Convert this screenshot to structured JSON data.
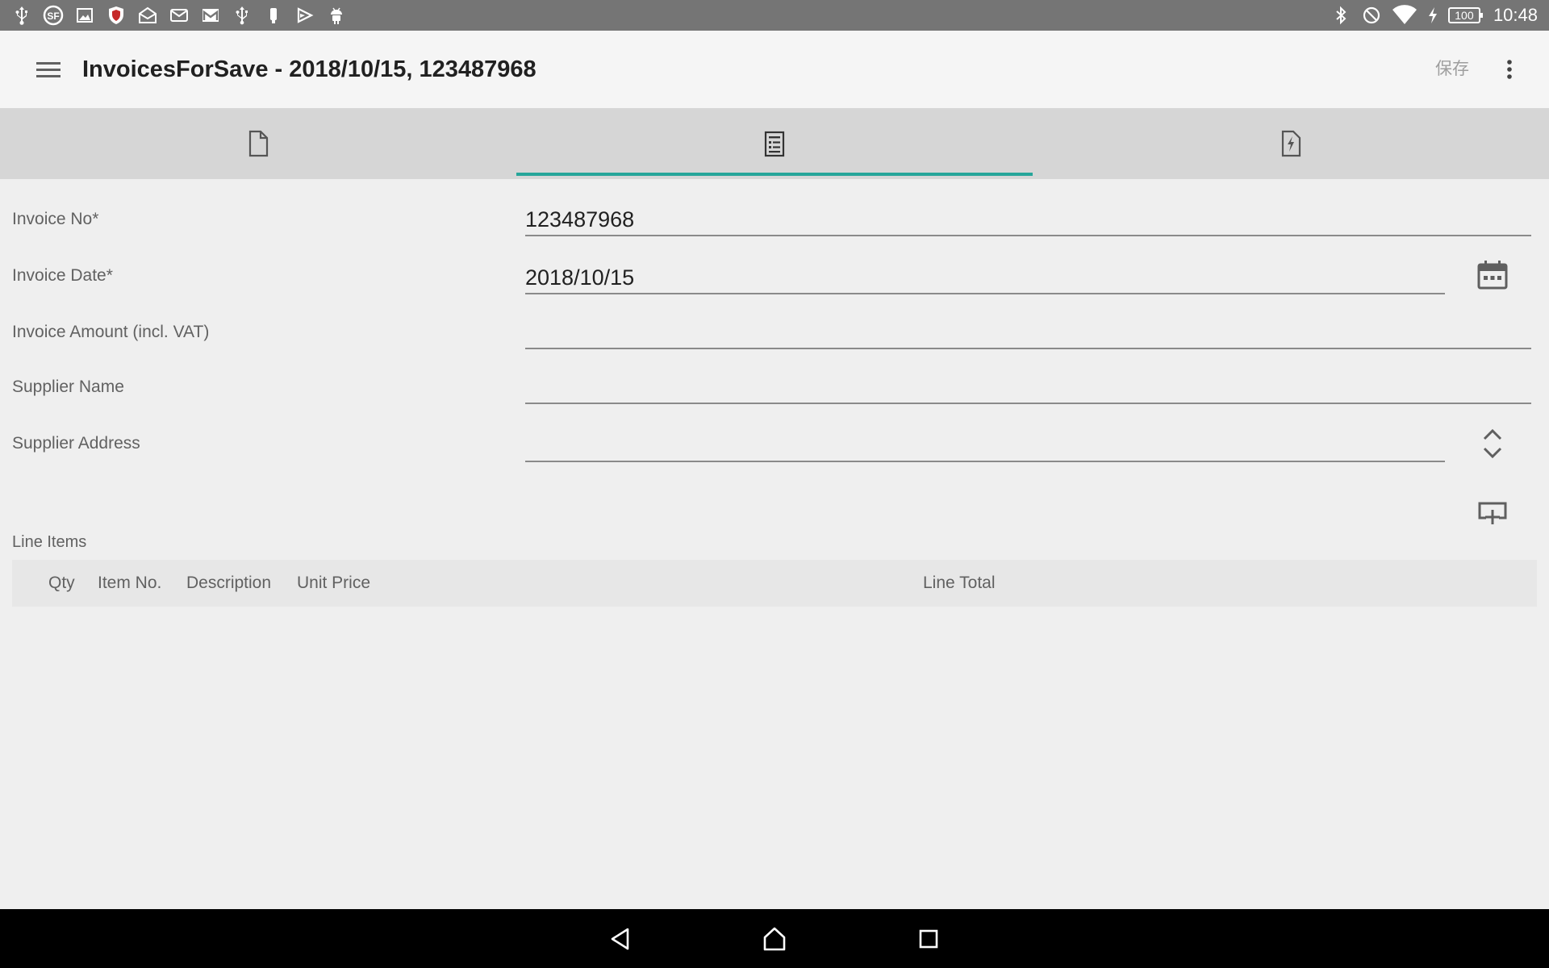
{
  "status_bar": {
    "time": "10:48",
    "battery": "100",
    "left_icons": [
      "usb-icon",
      "sf-app-icon",
      "image-icon",
      "shield-app-icon",
      "mail-open-icon",
      "mail-icon",
      "gmail-icon",
      "usb-debug-icon",
      "device-icon",
      "play-store-icon",
      "android-icon"
    ],
    "right_icons": [
      "bluetooth-icon",
      "do-not-disturb-icon",
      "wifi-icon",
      "charging-icon",
      "battery-icon"
    ]
  },
  "app_bar": {
    "title": "InvoicesForSave - 2018/10/15, 123487968",
    "save_label": "保存"
  },
  "tabs": [
    {
      "icon": "document-icon",
      "selected": false
    },
    {
      "icon": "form-list-icon",
      "selected": true
    },
    {
      "icon": "document-flash-icon",
      "selected": false
    }
  ],
  "form": {
    "invoice_no": {
      "label": "Invoice No*",
      "value": "123487968"
    },
    "invoice_date": {
      "label": "Invoice Date*",
      "value": "2018/10/15"
    },
    "invoice_amount": {
      "label": "Invoice Amount (incl. VAT)",
      "value": ""
    },
    "supplier_name": {
      "label": "Supplier Name",
      "value": ""
    },
    "supplier_address": {
      "label": "Supplier Address",
      "value": ""
    }
  },
  "line_items": {
    "title": "Line Items",
    "columns": [
      "Qty",
      "Item No.",
      "Description",
      "Unit Price",
      "Line Total"
    ]
  },
  "colors": {
    "accent": "#26a69a",
    "status_bar": "#757575",
    "tab_bar": "#d6d6d6",
    "nav_bar": "#000000"
  }
}
